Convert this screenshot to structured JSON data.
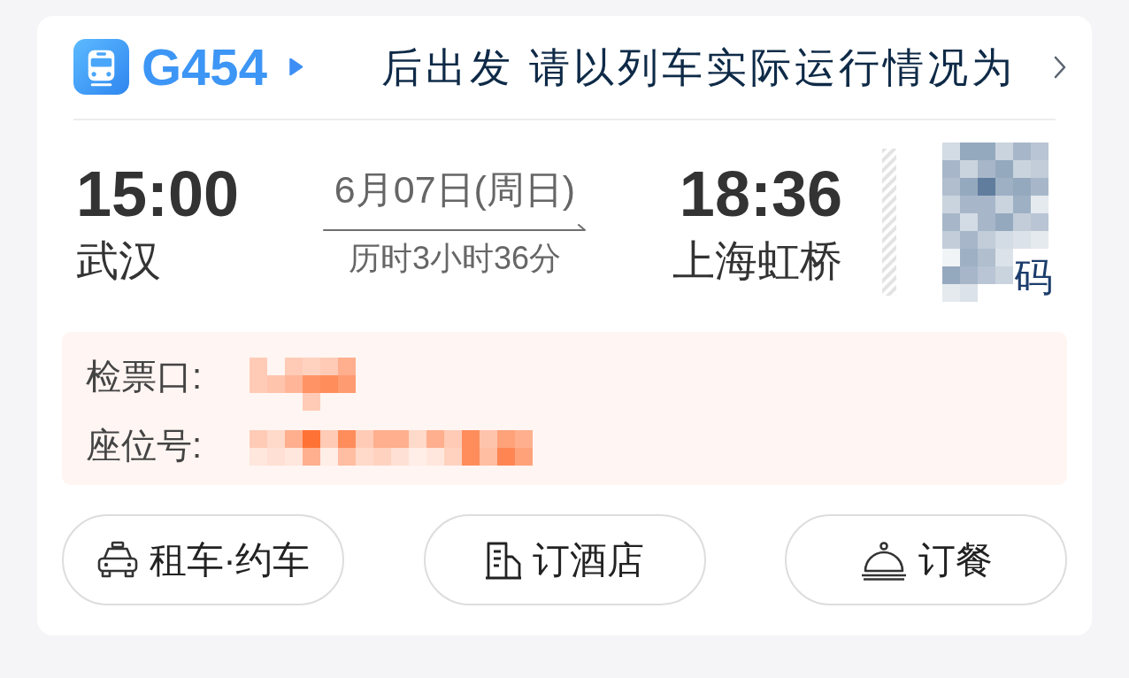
{
  "train": {
    "number": "G454",
    "notice": "后出发 请以列车实际运行情况为"
  },
  "journey": {
    "departure": {
      "time": "15:00",
      "station": "武汉"
    },
    "date": "6月07日(周日)",
    "duration": "历时3小时36分",
    "arrival": {
      "time": "18:36",
      "station": "上海虹桥"
    }
  },
  "ride_code": {
    "label": "码"
  },
  "ticket_info": [
    {
      "label": "检票口:"
    },
    {
      "label": "座位号:"
    }
  ],
  "actions": [
    {
      "kind": "taxi",
      "label": "租车·约车"
    },
    {
      "kind": "hotel",
      "label": "订酒店"
    },
    {
      "kind": "dining",
      "label": "订餐"
    }
  ]
}
